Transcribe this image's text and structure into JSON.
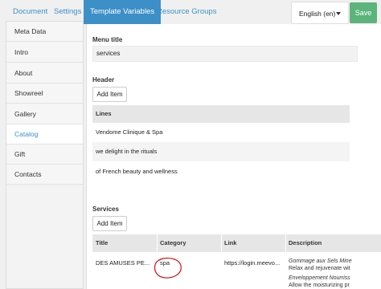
{
  "top_tabs": [
    {
      "label": "Document"
    },
    {
      "label": "Settings"
    },
    {
      "label": "Template Variables"
    },
    {
      "label": "Resource Groups"
    }
  ],
  "language": {
    "selected": "English (en)"
  },
  "save_label": "Save",
  "sidebar": {
    "items": [
      {
        "label": "Meta Data"
      },
      {
        "label": "Intro"
      },
      {
        "label": "About"
      },
      {
        "label": "Showreel"
      },
      {
        "label": "Gallery"
      },
      {
        "label": "Catalog"
      },
      {
        "label": "Gift"
      },
      {
        "label": "Contacts"
      }
    ],
    "active": "Catalog"
  },
  "menu_title": {
    "label": "Menu title",
    "value": "services"
  },
  "header": {
    "label": "Header",
    "add_label": "Add Item",
    "column": "Lines",
    "lines": [
      "Vendome Clinique & Spa",
      "we delight in the rituals",
      "of French beauty and wellness"
    ]
  },
  "services": {
    "label": "Services",
    "add_label": "Add Item",
    "columns": [
      "Title",
      "Category",
      "Link",
      "Description"
    ],
    "rows": [
      {
        "title": "DES AMUSES PE...",
        "category": "spa",
        "link": "https://login.meevo...",
        "description": [
          "Gommage aux Sels Mine",
          "Relax and rejuvenate wit",
          "Enveloppement Nourriss",
          "Allow the moisturizing pr"
        ]
      }
    ]
  },
  "colors": {
    "accent": "#3d8fc7",
    "save": "#5bb57a",
    "annotation": "#d42020"
  }
}
